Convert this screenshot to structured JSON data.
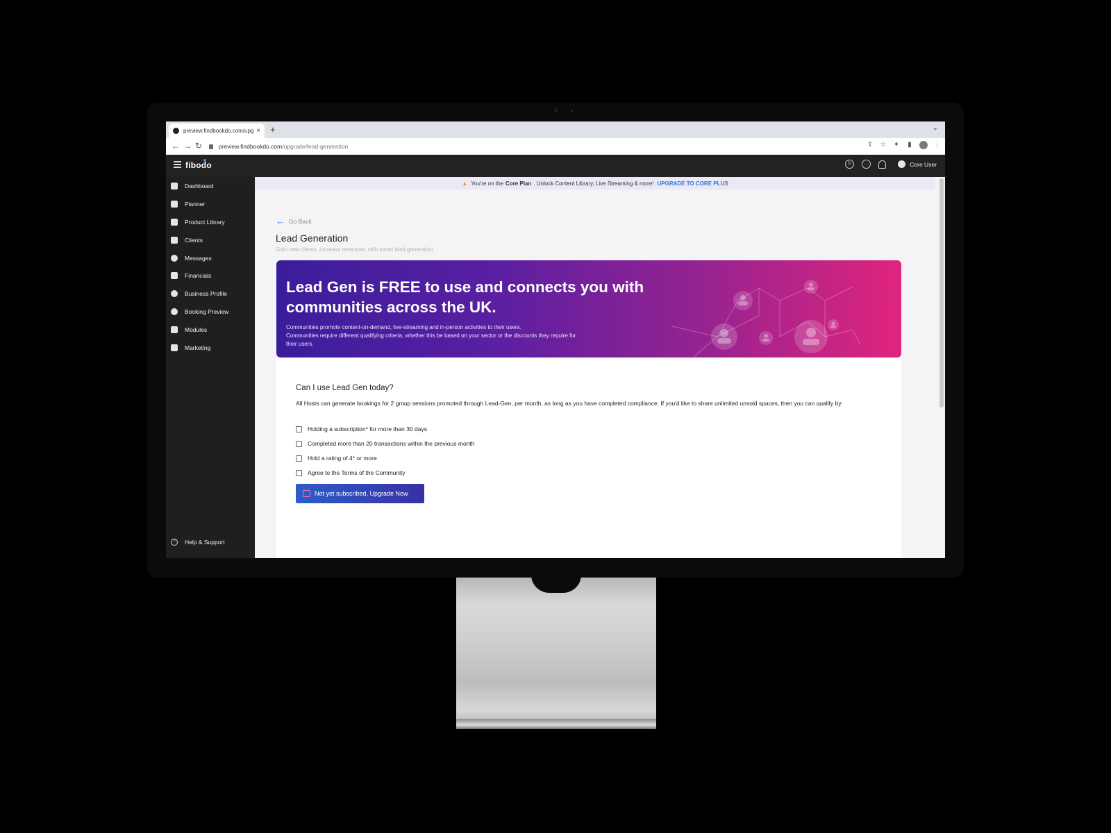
{
  "browser": {
    "tab_title": "preview.findbookdo.com/upgrade/lead-generation",
    "url_host": "preview.findbookdo.com",
    "url_path": "/upgrade/lead-generation"
  },
  "app": {
    "logo": "fibodo",
    "user_name": "Core User"
  },
  "sidebar": {
    "items": [
      {
        "label": "Dashboard",
        "icon": "home-icon"
      },
      {
        "label": "Planner",
        "icon": "calendar-icon"
      },
      {
        "label": "Product Library",
        "icon": "grid-icon"
      },
      {
        "label": "Clients",
        "icon": "id-card-icon"
      },
      {
        "label": "Messages",
        "icon": "chat-icon"
      },
      {
        "label": "Financials",
        "icon": "bar-chart-icon"
      },
      {
        "label": "Business Profile",
        "icon": "gear-icon"
      },
      {
        "label": "Booking Preview",
        "icon": "eye-icon"
      },
      {
        "label": "Modules",
        "icon": "box-icon"
      },
      {
        "label": "Marketing",
        "icon": "megaphone-icon"
      }
    ],
    "help": "Help & Support"
  },
  "plan_banner": {
    "prefix": "You're on the",
    "plan": "Core Plan",
    "suffix": ". Unlock Content Library, Live Streaming & more!",
    "upgrade": "UPGRADE TO CORE PLUS"
  },
  "page": {
    "back": "Go Back",
    "title": "Lead Generation",
    "subtitle": "Gain new clients, increase revenues, with smart lead generation."
  },
  "hero": {
    "title": "Lead Gen is FREE to use and connects you with communities across the UK.",
    "desc_1": "Communities promote content-on-demand, live-streaming and in-person activities to their users.",
    "desc_2": "Communities require different qualifying criteria, whether this be based on your sector or the discounts they require for their users."
  },
  "card": {
    "heading": "Can I use Lead Gen today?",
    "paragraph": "All Hosts can generate bookings for 2 group sessions promoted through Lead-Gen, per month, as long as you have completed compliance. If you'd like to share unlimited unsold spaces, then you can qualify by:",
    "criteria": [
      "Holding a subscription* for more than 30 days",
      "Completed more than 20 transactions within the previous month",
      "Hold a rating of 4* or more",
      "Agree to the Terms of the Community"
    ],
    "cta": "Not yet subscribed, Upgrade Now"
  },
  "colors": {
    "accent": "#2f79d6",
    "hero_start": "#3a1d9c",
    "hero_end": "#e0247d",
    "sidebar_bg": "#1f1f1f"
  }
}
